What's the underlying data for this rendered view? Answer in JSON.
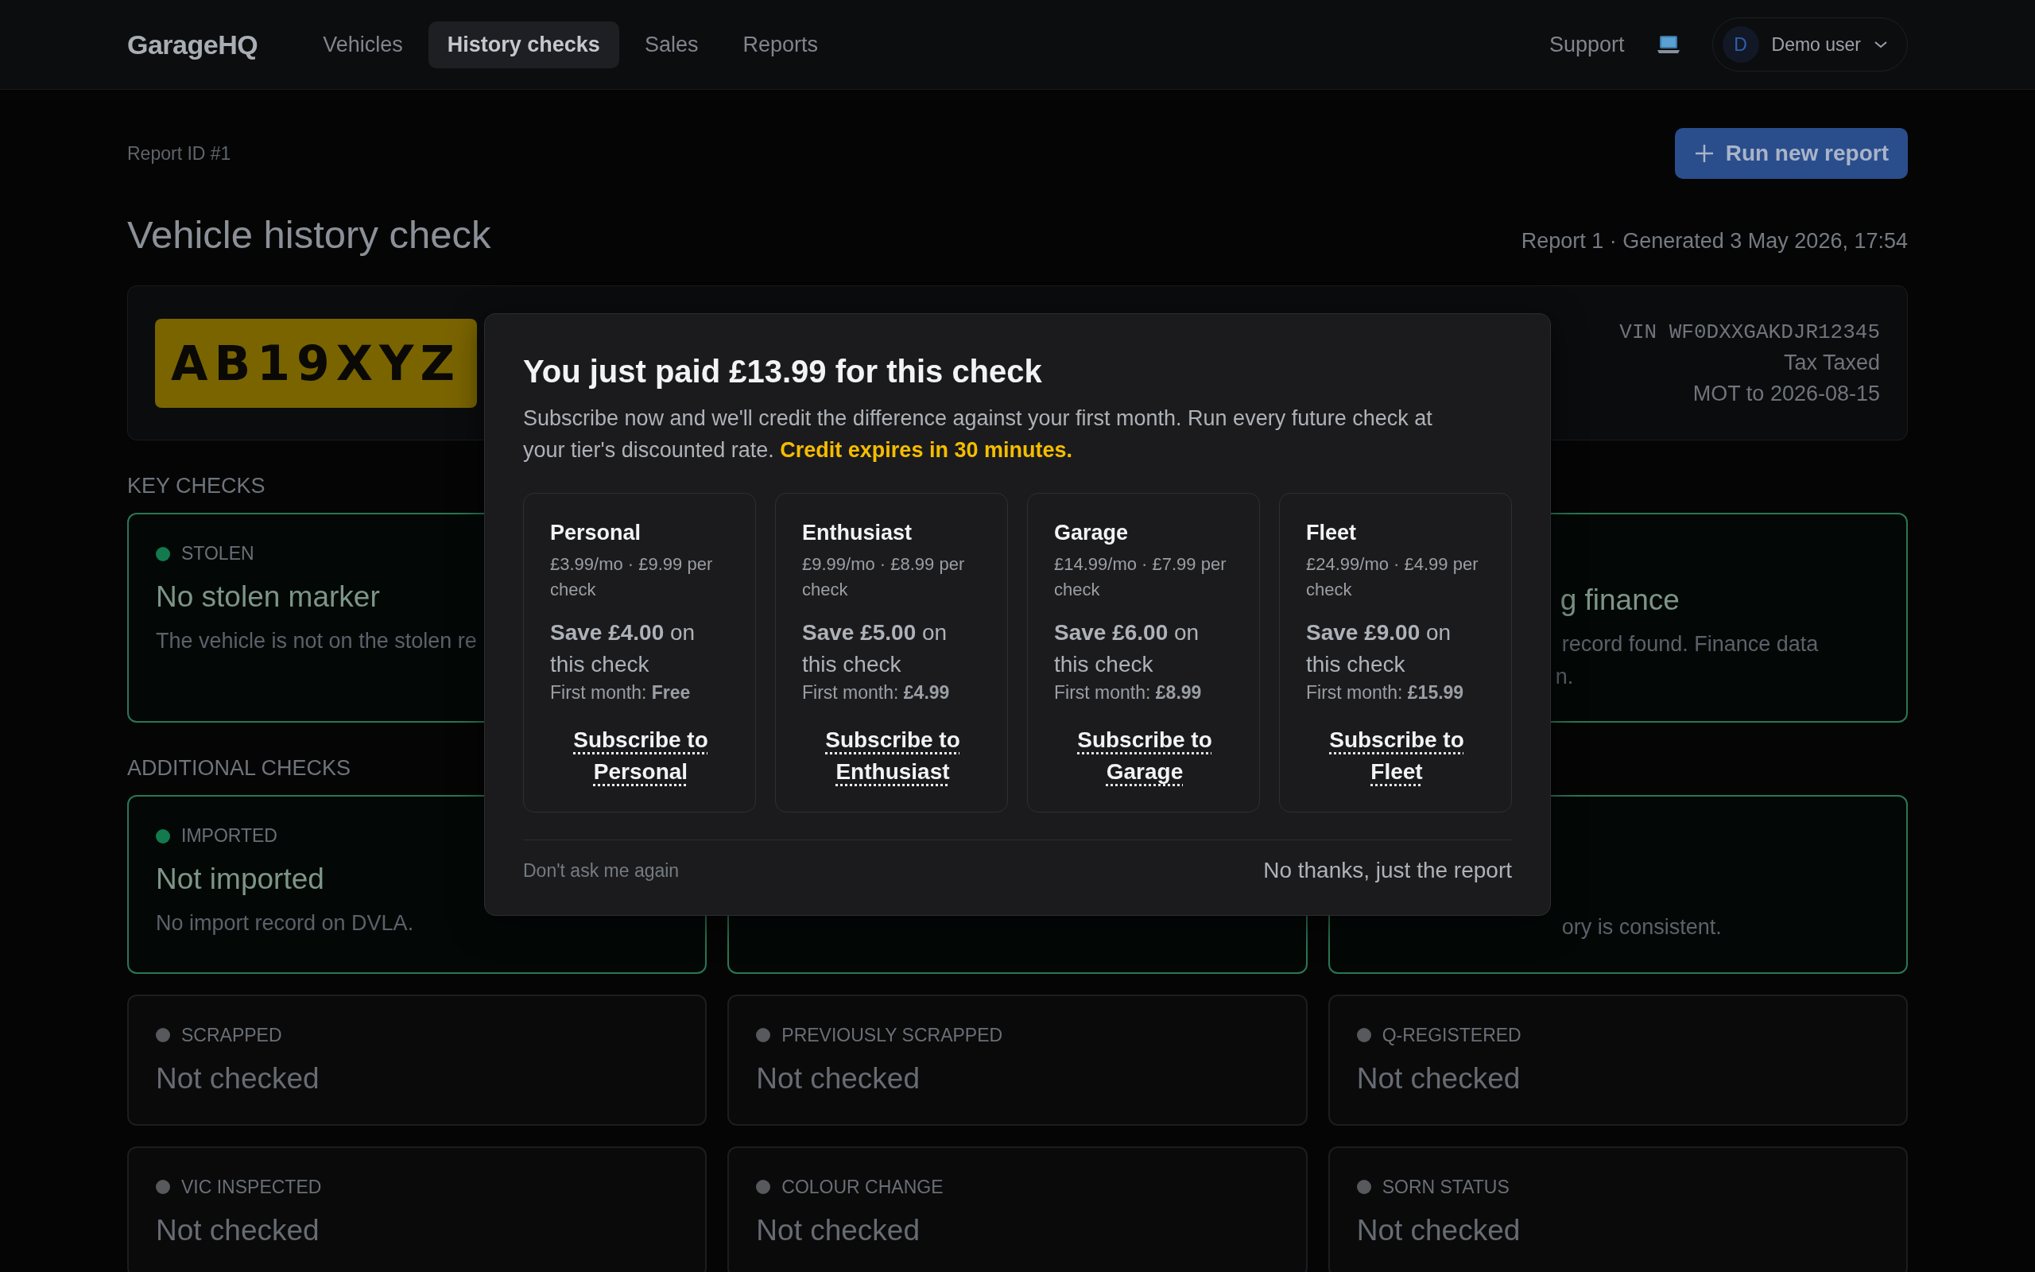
{
  "header": {
    "logo": "GarageHQ",
    "nav": [
      {
        "label": "Vehicles",
        "selected": false
      },
      {
        "label": "History checks",
        "selected": true
      },
      {
        "label": "Sales",
        "selected": false
      },
      {
        "label": "Reports",
        "selected": false
      }
    ],
    "support": "Support",
    "user": {
      "initial": "D",
      "name": "Demo user"
    }
  },
  "report": {
    "id_label": "Report ID #1",
    "run_button": "Run new report",
    "title": "Vehicle history check",
    "generated": "Report 1 · Generated 3 May 2026, 17:54",
    "plate": "AB19XYZ",
    "vin": "VIN WF0DXXGAKDJR12345",
    "tax": "Tax Taxed",
    "mot": "MOT to 2026-08-15"
  },
  "sections": [
    {
      "heading": "KEY CHECKS",
      "cards": [
        {
          "checked": true,
          "label": "STOLEN",
          "title": "No stolen marker",
          "description_lines": [
            "The vehicle is not on the stolen re"
          ]
        },
        {
          "checked": true,
          "title": "g finance",
          "description_lines": [
            "record found. Finance data",
            "n."
          ]
        }
      ]
    },
    {
      "heading": "ADDITIONAL CHECKS",
      "cards": [
        {
          "checked": true,
          "label": "IMPORTED",
          "title": "Not imported",
          "description_lines": [
            "No import record on DVLA."
          ]
        },
        {
          "checked": true
        },
        {
          "checked": true,
          "description_lines": [
            "ory is consistent."
          ]
        },
        {
          "checked": false,
          "label": "SCRAPPED",
          "title": "Not checked"
        },
        {
          "checked": false,
          "label": "PREVIOUSLY SCRAPPED",
          "title": "Not checked"
        },
        {
          "checked": false,
          "label": "Q-REGISTERED",
          "title": "Not checked"
        },
        {
          "checked": false,
          "label": "VIC INSPECTED",
          "title": "Not checked"
        },
        {
          "checked": false,
          "label": "COLOUR CHANGE",
          "title": "Not checked"
        },
        {
          "checked": false,
          "label": "SORN STATUS",
          "title": "Not checked"
        }
      ]
    }
  ],
  "modal": {
    "title": "You just paid £13.99 for this check",
    "description": "Subscribe now and we'll credit the difference against your first month. Run every future check at your tier's discounted rate. **Credit expires in 30 minutes.**",
    "plans": [
      {
        "name": "Personal",
        "price": "£3.99/mo · £9.99 per check",
        "saving": "**Save £4.00** on this check",
        "first_month": "First month: **Free**",
        "link": "Subscribe to Personal"
      },
      {
        "name": "Enthusiast",
        "price": "£9.99/mo · £8.99 per check",
        "saving": "**Save £5.00** on this check",
        "first_month": "First month: **£4.99**",
        "link": "Subscribe to Enthusiast"
      },
      {
        "name": "Garage",
        "price": "£14.99/mo · £7.99 per check",
        "saving": "**Save £6.00** on this check",
        "first_month": "First month: **£8.99**",
        "link": "Subscribe to Garage"
      },
      {
        "name": "Fleet",
        "price": "£24.99/mo · £4.99 per check",
        "saving": "**Save £9.00** on this check",
        "first_month": "First month: **£15.99**",
        "link": "Subscribe to Fleet"
      }
    ],
    "dont_ask": "Don't ask me again",
    "dismiss": "No thanks, just the report"
  }
}
